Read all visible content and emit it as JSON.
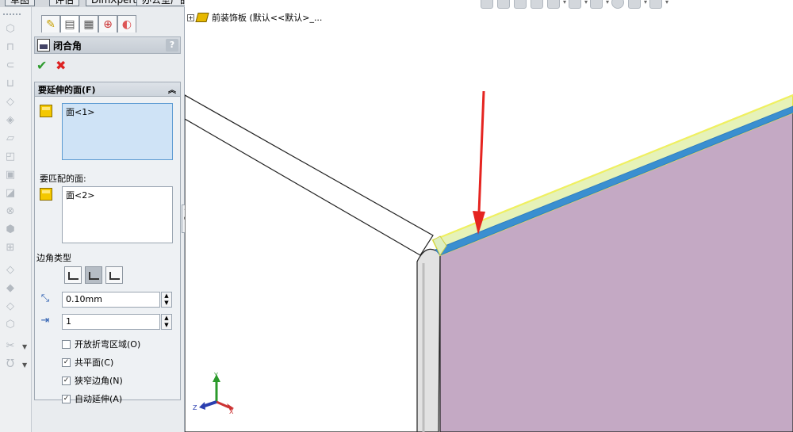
{
  "top_tabs": [
    "草图",
    "评估",
    "DimXpert",
    "办公室产品"
  ],
  "feature_tree": {
    "item": "前装饰板  (默认<<默认>_..."
  },
  "property_manager": {
    "title": "闭合角",
    "help": "?",
    "ok_symbol": "✔",
    "cancel_symbol": "✖",
    "group_title": "要延伸的面(F)",
    "faces_to_extend": [
      "面<1>"
    ],
    "faces_to_match_label": "要匹配的面:",
    "faces_to_match": [
      "面<2>"
    ],
    "corner_type_label": "边角类型",
    "corner_types": [
      "butt",
      "overlap",
      "underlap"
    ],
    "selected_corner_type": 1,
    "gap_distance": "0.10mm",
    "overlap_ratio": "1",
    "options": [
      {
        "label": "开放折弯区域(O)",
        "checked": false
      },
      {
        "label": "共平面(C)",
        "checked": true
      },
      {
        "label": "狭窄边角(N)",
        "checked": true
      },
      {
        "label": "自动延伸(A)",
        "checked": true
      }
    ]
  },
  "triad": {
    "x": "X",
    "y": "Y",
    "z": "Z"
  },
  "colors": {
    "face_fill": "#c4a9c4",
    "selected_edge": "#3a8fd0",
    "highlight_edge": "#f0f060",
    "arrow": "#e52420",
    "panel_bg": "#e9ecef"
  },
  "strip_icons": [
    "sheetmetal-icon",
    "base-flange-icon",
    "edge-flange-icon",
    "miter-flange-icon",
    "hem-icon",
    "jog-icon",
    "sketched-bend-icon",
    "closed-corner-icon",
    "welded-corner-icon",
    "break-corner-icon",
    "corner-relief-icon",
    "forming-tool-icon",
    "flatten-icon",
    "no-bends-icon",
    "rip-icon",
    "convert-icon",
    "lofted-bend-icon",
    "extruded-cut-icon",
    "simple-hole-icon",
    "vent-icon",
    "unfold-icon",
    "fold-icon"
  ]
}
